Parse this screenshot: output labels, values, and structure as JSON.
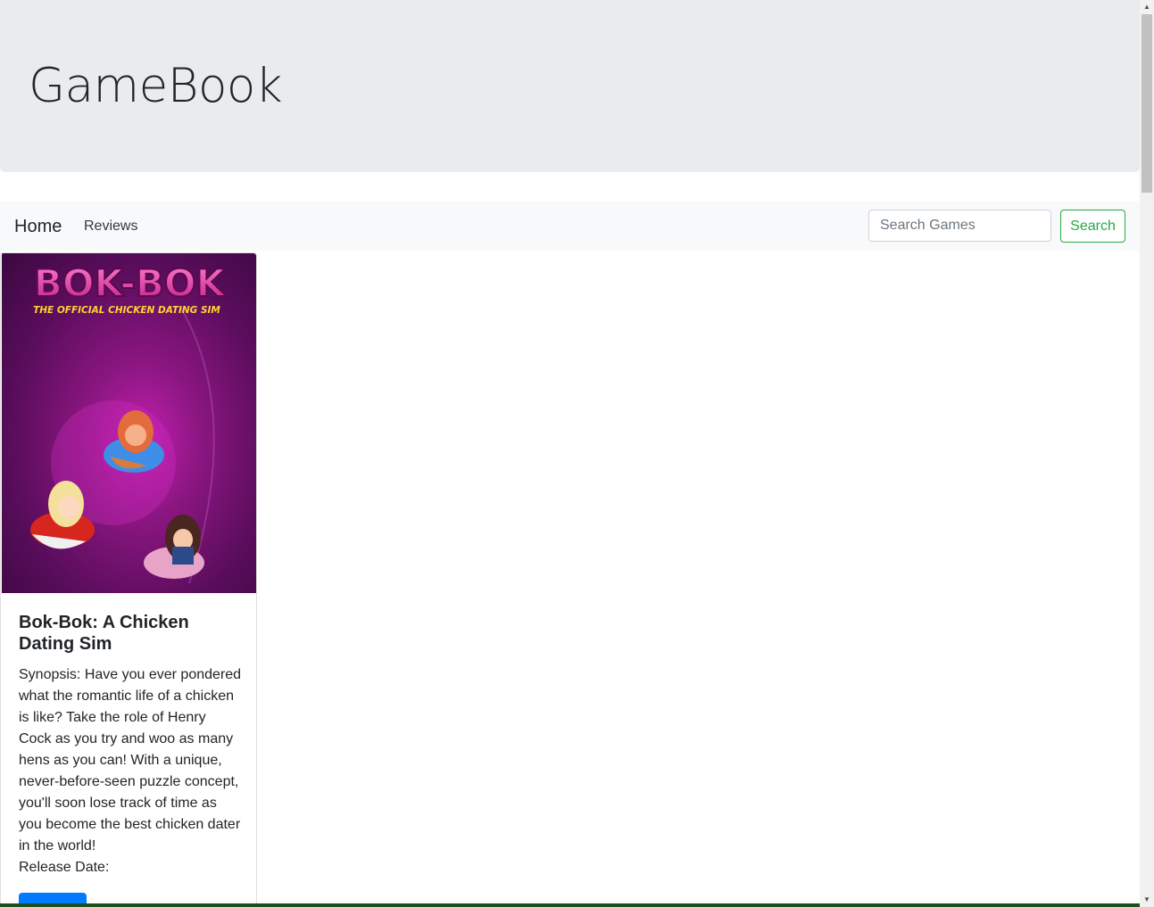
{
  "header": {
    "title": "GameBook"
  },
  "navbar": {
    "brand": "Home",
    "links": [
      "Reviews"
    ],
    "search_placeholder": "Search Games",
    "search_button": "Search"
  },
  "card": {
    "image": {
      "logo_text": "BOK-BOK",
      "subtitle_text": "THE OFFICIAL CHICKEN DATING SIM"
    },
    "title": "Bok-Bok: A Chicken Dating Sim",
    "synopsis": "Synopsis: Have you ever pondered what the romantic life of a chicken is like? Take the role of Henry Cock as you try and woo as many hens as you can! With a unique, never-before-seen puzzle concept, you'll soon lose track of time as you become the best chicken dater in the world!",
    "release": "Release Date:"
  },
  "colors": {
    "jumbotron_bg": "#e9ecef",
    "navbar_bg": "#f8f9fa",
    "search_button": "#28a745",
    "card_button": "#007bff"
  }
}
